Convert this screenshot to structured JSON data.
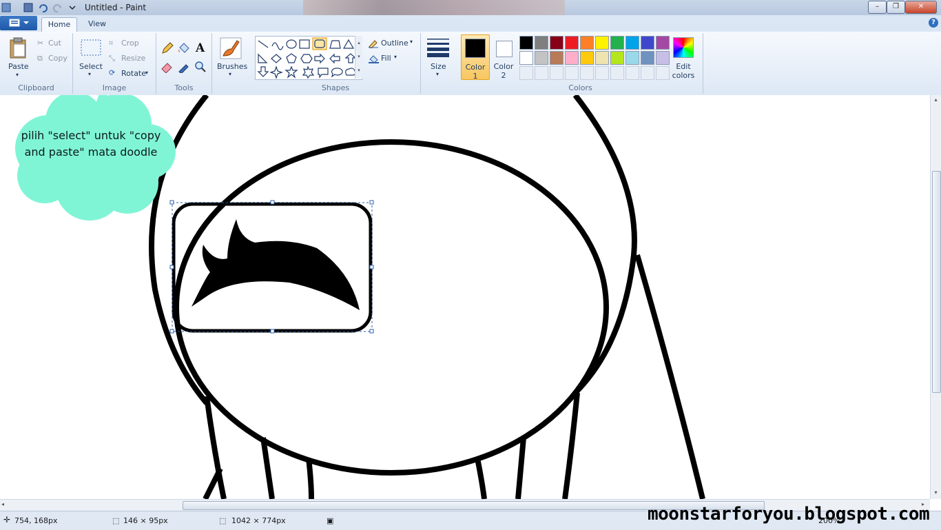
{
  "window": {
    "title": "Untitled - Paint",
    "minimize_label": "–",
    "maximize_label": "❐",
    "close_label": "✕"
  },
  "tabs": [
    {
      "label": "Home",
      "active": true
    },
    {
      "label": "View",
      "active": false
    }
  ],
  "help_label": "?",
  "ribbon": {
    "clipboard": {
      "group_label": "Clipboard",
      "paste": "Paste",
      "cut": "Cut",
      "copy": "Copy"
    },
    "image": {
      "group_label": "Image",
      "select": "Select",
      "crop": "Crop",
      "resize": "Resize",
      "rotate": "Rotate"
    },
    "tools": {
      "group_label": "Tools",
      "text_glyph": "A"
    },
    "brushes": {
      "label": "Brushes"
    },
    "shapes": {
      "group_label": "Shapes",
      "outline": "Outline",
      "fill": "Fill"
    },
    "size": {
      "label": "Size"
    },
    "colors": {
      "group_label": "Colors",
      "color1_line1": "Color",
      "color1_line2": "1",
      "color2_line1": "Color",
      "color2_line2": "2",
      "edit_line1": "Edit",
      "edit_line2": "colors",
      "color1": "#000000",
      "color2": "#ffffff",
      "palette_row1": [
        "#000000",
        "#7f7f7f",
        "#880015",
        "#ed1c24",
        "#ff7f27",
        "#fff200",
        "#22b14c",
        "#00a2e8",
        "#3f48cc",
        "#a349a4"
      ],
      "palette_row2": [
        "#ffffff",
        "#c3c3c3",
        "#b97a57",
        "#ffaec9",
        "#ffc90e",
        "#efe4b0",
        "#b5e61d",
        "#99d9ea",
        "#7092be",
        "#c8bfe7"
      ]
    }
  },
  "annotation": {
    "text": "pilih \"select\" untuk \"copy and paste\" mata doodle",
    "bubble_color": "#80f5d6"
  },
  "statusbar": {
    "cursor_pos": "754, 168px",
    "selection_size": "146 × 95px",
    "image_size": "1042 × 774px",
    "zoom": "200%"
  },
  "watermark": "moonstarforyou.blogspot.com"
}
